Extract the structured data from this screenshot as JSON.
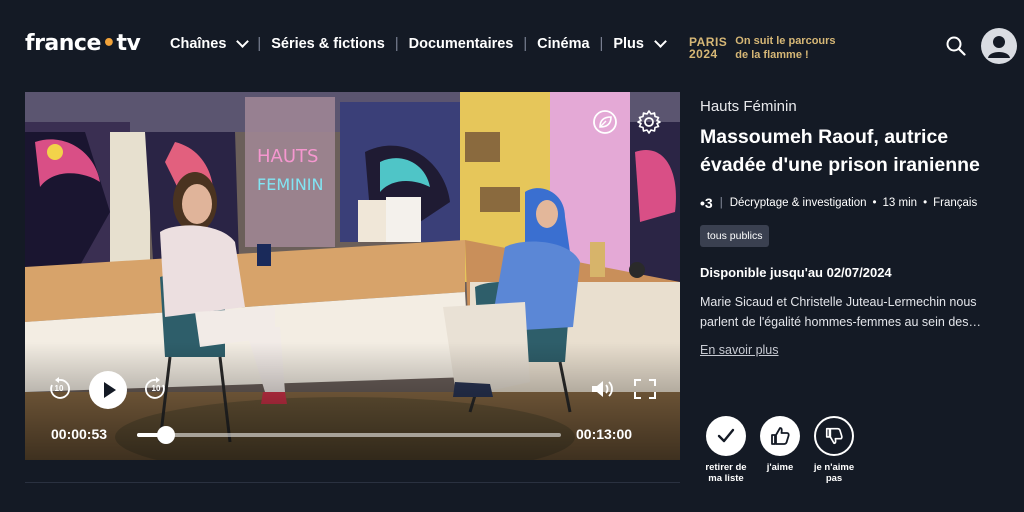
{
  "header": {
    "logo": {
      "part1": "france",
      "dot": "•",
      "part2": "tv"
    },
    "nav": [
      {
        "label": "Chaînes",
        "dropdown": true
      },
      {
        "label": "Séries & fictions",
        "dropdown": false
      },
      {
        "label": "Documentaires",
        "dropdown": false
      },
      {
        "label": "Cinéma",
        "dropdown": false
      },
      {
        "label": "Plus",
        "dropdown": true
      }
    ],
    "separator": "|",
    "paris": {
      "line1": "PARIS",
      "line2": "2024",
      "text1": "On suit le parcours",
      "text2": "de la flamme !"
    },
    "icons": {
      "search": "search-icon",
      "avatar": "user-avatar-icon"
    }
  },
  "player": {
    "current_time": "00:00:53",
    "total_time": "00:13:00",
    "progress": 0.068,
    "skip_back_seconds": "10",
    "skip_forward_seconds": "10",
    "icons": [
      "replay-10-icon",
      "play-icon",
      "forward-10-icon",
      "volume-icon",
      "fullscreen-icon",
      "leaf-icon",
      "settings-gear-icon"
    ]
  },
  "info": {
    "program": "Hauts Féminin",
    "title": "Massoumeh Raouf, autrice évadée d'une prison iranienne",
    "channel": "•3",
    "category": "Décryptage & investigation",
    "duration": "13 min",
    "language": "Français",
    "bullet": "•",
    "badge": "tous publics",
    "availability": "Disponible jusqu'au 02/07/2024",
    "description": "Marie Sicaud et Christelle Juteau-Lermechin nous parlent de l'égalité hommes-femmes au sein des…",
    "more_link": "En savoir plus"
  },
  "actions": [
    {
      "label": "retirer de ma liste",
      "icon": "checkmark-icon"
    },
    {
      "label": "j'aime",
      "icon": "thumbs-up-icon"
    },
    {
      "label": "je n'aime pas",
      "icon": "thumbs-down-icon"
    }
  ],
  "colors": {
    "background": "#141a25",
    "accent_orange": "#f2a33a",
    "paris_gold": "#d6b776"
  }
}
